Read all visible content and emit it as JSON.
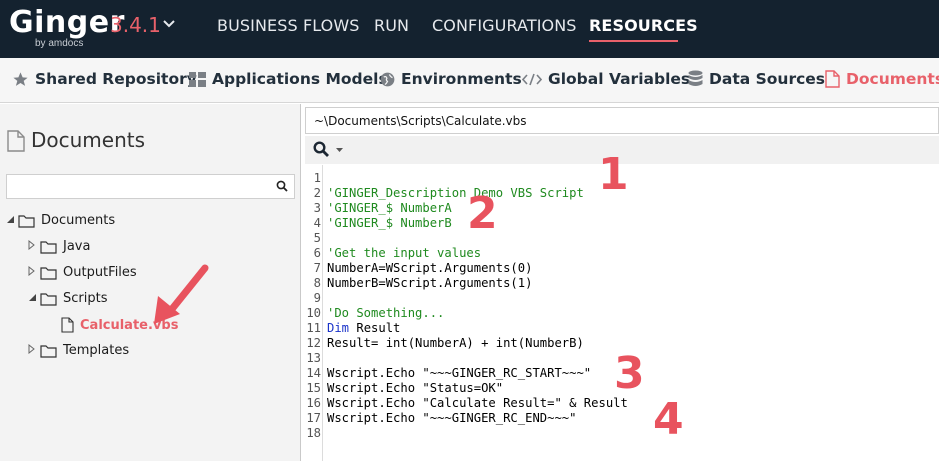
{
  "app": {
    "logo": "Ginger",
    "logo_sub": "by amdocs",
    "version": "3.4.1"
  },
  "nav": {
    "items": [
      "BUSINESS FLOWS",
      "RUN",
      "CONFIGURATIONS",
      "RESOURCES"
    ],
    "active": "RESOURCES"
  },
  "subnav": {
    "items": [
      {
        "label": "Shared Repository",
        "icon": "star-icon"
      },
      {
        "label": "Applications Models",
        "icon": "grid-icon"
      },
      {
        "label": "Environments",
        "icon": "globe-icon"
      },
      {
        "label": "Global  Variables",
        "icon": "code-icon"
      },
      {
        "label": "Data Sources",
        "icon": "database-icon"
      },
      {
        "label": "Documents",
        "icon": "document-icon"
      }
    ],
    "active": "Documents"
  },
  "left_panel": {
    "title": "Documents",
    "search_value": "",
    "tree": [
      {
        "label": "Documents",
        "type": "folder",
        "expanded": true
      },
      {
        "label": "Java",
        "type": "folder",
        "expanded": false
      },
      {
        "label": "OutputFiles",
        "type": "folder",
        "expanded": false
      },
      {
        "label": "Scripts",
        "type": "folder",
        "expanded": true
      },
      {
        "label": "Calculate.vbs",
        "type": "file",
        "selected": true
      },
      {
        "label": "Templates",
        "type": "folder",
        "expanded": false
      }
    ]
  },
  "editor": {
    "path": "~\\Documents\\Scripts\\Calculate.vbs",
    "lines": [
      {
        "n": "1",
        "text": ""
      },
      {
        "n": "2",
        "text": "'GINGER_Description Demo VBS Script",
        "kind": "comment"
      },
      {
        "n": "3",
        "text": "'GINGER_$ NumberA",
        "kind": "comment"
      },
      {
        "n": "4",
        "text": "'GINGER_$ NumberB",
        "kind": "comment"
      },
      {
        "n": "5",
        "text": ""
      },
      {
        "n": "6",
        "text": "'Get the input values",
        "kind": "comment"
      },
      {
        "n": "7",
        "text": "NumberA=WScript.Arguments(0)"
      },
      {
        "n": "8",
        "text": "NumberB=WScript.Arguments(1)"
      },
      {
        "n": "9",
        "text": ""
      },
      {
        "n": "10",
        "text": "'Do Something...",
        "kind": "comment"
      },
      {
        "n": "11",
        "kw": "Dim",
        "text": " Result"
      },
      {
        "n": "12",
        "text": "Result= int(NumberA) + int(NumberB)"
      },
      {
        "n": "13",
        "text": ""
      },
      {
        "n": "14",
        "text": "Wscript.Echo \"~~~GINGER_RC_START~~~\""
      },
      {
        "n": "15",
        "text": "Wscript.Echo \"Status=OK\""
      },
      {
        "n": "16",
        "text": "Wscript.Echo \"Calculate Result=\" & Result"
      },
      {
        "n": "17",
        "text": "Wscript.Echo \"~~~GINGER_RC_END~~~\""
      },
      {
        "n": "18",
        "text": ""
      }
    ]
  },
  "annotations": [
    "1",
    "2",
    "3",
    "4"
  ],
  "colors": {
    "topbar": "#14222f",
    "accent": "#e8616a",
    "comment": "#1f8a1f",
    "keyword": "#1a33c9"
  }
}
